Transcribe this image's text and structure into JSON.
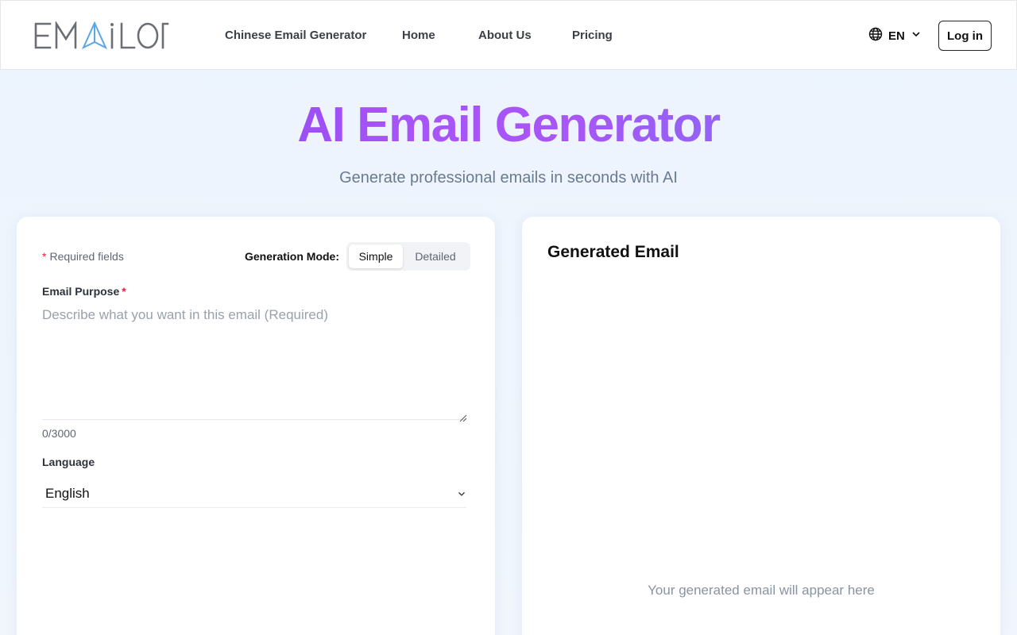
{
  "header": {
    "logo_text": "EMAILOR",
    "nav": [
      {
        "label": "Chinese Email Generator"
      },
      {
        "label": "Home"
      },
      {
        "label": "About Us"
      },
      {
        "label": "Pricing"
      }
    ],
    "language": {
      "code": "EN",
      "icon": "globe-icon"
    },
    "login_label": "Log in"
  },
  "hero": {
    "title": "AI Email Generator",
    "subtitle": "Generate professional emails in seconds with AI"
  },
  "form": {
    "required_note": "Required fields",
    "required_star": "*",
    "mode_label": "Generation Mode:",
    "modes": [
      {
        "label": "Simple",
        "active": true
      },
      {
        "label": "Detailed",
        "active": false
      }
    ],
    "purpose_label": "Email Purpose",
    "purpose_placeholder": "Describe what you want in this email (Required)",
    "purpose_value": "",
    "counter": "0/3000",
    "language_label": "Language",
    "language_value": "English"
  },
  "output": {
    "title": "Generated Email",
    "placeholder": "Your generated email will appear here"
  },
  "colors": {
    "title_gradient_start": "#7c3aed",
    "title_gradient_end": "#6d7cf0",
    "required_star": "#e11d48",
    "background": "#eef5fd"
  }
}
